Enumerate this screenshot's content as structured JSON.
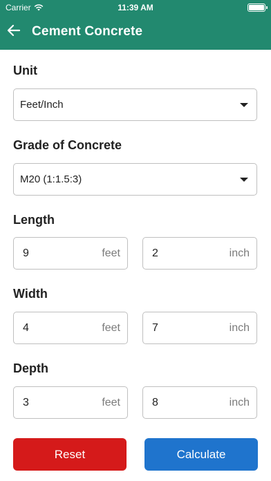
{
  "status_bar": {
    "carrier": "Carrier",
    "time": "11:39 AM"
  },
  "header": {
    "title": "Cement Concrete",
    "back_icon": "arrow-left-icon"
  },
  "unit": {
    "label": "Unit",
    "value": "Feet/Inch"
  },
  "grade": {
    "label": "Grade of Concrete",
    "value": "M20 (1:1.5:3)"
  },
  "length": {
    "label": "Length",
    "feet": "9",
    "feet_unit": "feet",
    "inch": "2",
    "inch_unit": "inch"
  },
  "width": {
    "label": "Width",
    "feet": "4",
    "feet_unit": "feet",
    "inch": "7",
    "inch_unit": "inch"
  },
  "depth": {
    "label": "Depth",
    "feet": "3",
    "feet_unit": "feet",
    "inch": "8",
    "inch_unit": "inch"
  },
  "buttons": {
    "reset": "Reset",
    "calculate": "Calculate"
  },
  "colors": {
    "appbar": "#22896f",
    "reset": "#d51a1a",
    "calculate": "#1f74cd"
  }
}
